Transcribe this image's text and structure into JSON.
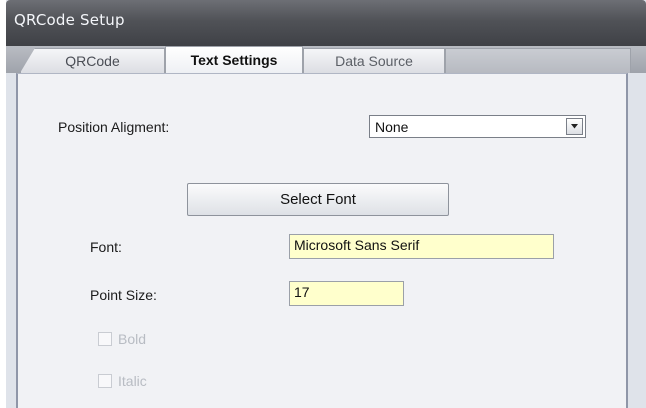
{
  "window": {
    "title": "QRCode Setup"
  },
  "tabs": [
    {
      "label": "QRCode",
      "active": false
    },
    {
      "label": "Text Settings",
      "active": true
    },
    {
      "label": "Data Source",
      "active": false
    }
  ],
  "text_settings": {
    "position_alignment": {
      "label": "Position Aligment:",
      "selected": "None"
    },
    "select_font_button": "Select Font",
    "font": {
      "label": "Font:",
      "value": "Microsoft Sans Serif"
    },
    "point_size": {
      "label": "Point Size:",
      "value": "17"
    },
    "bold": {
      "label": "Bold",
      "checked": false,
      "enabled": false
    },
    "italic": {
      "label": "Italic",
      "checked": false,
      "enabled": false
    }
  },
  "colors": {
    "title_bar": "#505257",
    "field_background": "#ffffcc",
    "panel_background": "#f1f2f5"
  }
}
